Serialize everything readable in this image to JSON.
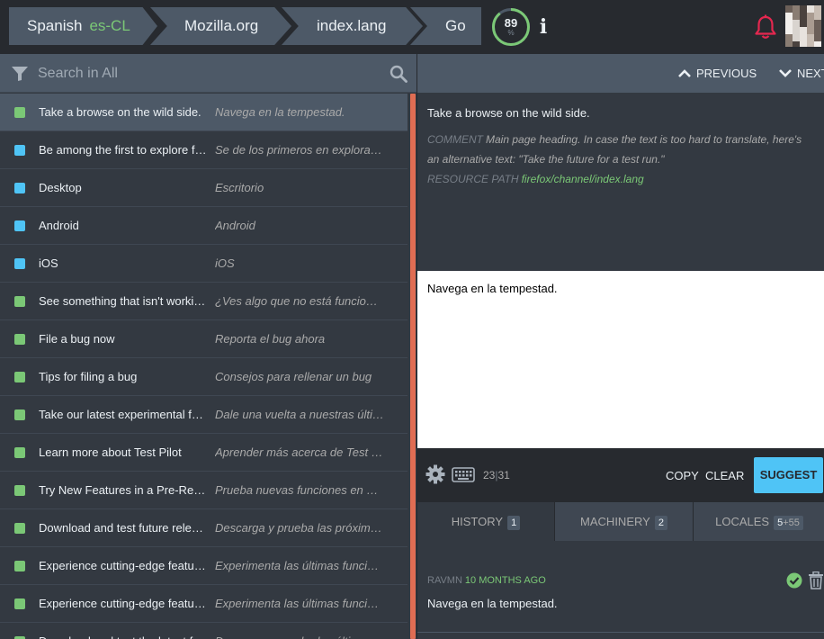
{
  "header": {
    "locale_name": "Spanish",
    "locale_code": "es-CL",
    "project": "Mozilla.org",
    "resource": "index.lang",
    "go_label": "Go",
    "progress_value": "89",
    "progress_unit": "%",
    "progress_fraction": 0.89,
    "info_icon": "info-icon",
    "notification_icon": "bell-icon"
  },
  "search": {
    "placeholder": "Search in All"
  },
  "entities": [
    {
      "status": "approved",
      "source": "Take a browse on the wild side.",
      "translation": "Navega en la tempestad.",
      "selected": true
    },
    {
      "status": "fuzzy",
      "source": "Be among the first to explore future versions of Firefox.",
      "translation": "Se de los primeros en explorar las futuras versiones de Firefox."
    },
    {
      "status": "fuzzy",
      "source": "Desktop",
      "translation": "Escritorio"
    },
    {
      "status": "fuzzy",
      "source": "Android",
      "translation": "Android"
    },
    {
      "status": "fuzzy",
      "source": "iOS",
      "translation": "iOS"
    },
    {
      "status": "approved",
      "source": "See something that isn't working?",
      "translation": "¿Ves algo que no está funcionando?"
    },
    {
      "status": "approved",
      "source": "File a bug now",
      "translation": "Reporta el bug ahora"
    },
    {
      "status": "approved",
      "source": "Tips for filing a bug",
      "translation": "Consejos para rellenar un bug"
    },
    {
      "status": "approved",
      "source": "Take our latest experimental features for a spin",
      "translation": "Dale una vuelta a nuestras últimas funciones experimentales"
    },
    {
      "status": "approved",
      "source": "Learn more about Test Pilot",
      "translation": "Aprender más acerca de Test Pilot"
    },
    {
      "status": "approved",
      "source": "Try New Features in a Pre-Release Version",
      "translation": "Prueba nuevas funciones en una versión preliminar"
    },
    {
      "status": "approved",
      "source": "Download and test future releases",
      "translation": "Descarga y prueba las próximas versiones"
    },
    {
      "status": "approved",
      "source": "Experience cutting-edge features",
      "translation": "Experimenta las últimas funciones"
    },
    {
      "status": "approved",
      "source": "Experience cutting-edge features",
      "translation": "Experimenta las últimas funciones"
    },
    {
      "status": "approved",
      "source": "Download and test the latest features",
      "translation": "Descarga y prueba las últimas funciones"
    }
  ],
  "navigation": {
    "previous_label": "PREVIOUS",
    "next_label": "NEXT"
  },
  "original": {
    "text": "Take a browse on the wild side.",
    "comment_label": "Comment",
    "comment_text": "Main page heading. In case the text is too hard to translate, here's an alternative text: \"Take the future for a test run.\"",
    "resource_label": "Resource path",
    "resource_path": "firefox/channel/index.lang"
  },
  "editor": {
    "value": "Navega en la tempestad.",
    "counter_current": "23",
    "counter_original": "31",
    "copy_label": "COPY",
    "clear_label": "CLEAR",
    "suggest_label": "SUGGEST"
  },
  "tabs": [
    {
      "label": "HISTORY",
      "count": "1"
    },
    {
      "label": "MACHINERY",
      "count": "2"
    },
    {
      "label": "LOCALES",
      "count_main": "5",
      "count_extra": "+55"
    }
  ],
  "history": {
    "author": "RAVMN",
    "when": "10 MONTHS AGO",
    "text": "Navega en la tempestad."
  },
  "colors": {
    "approved": "#7bc876",
    "fuzzy": "#4fc4f6",
    "accent": "#e06d53",
    "bell": "#e4274f"
  }
}
